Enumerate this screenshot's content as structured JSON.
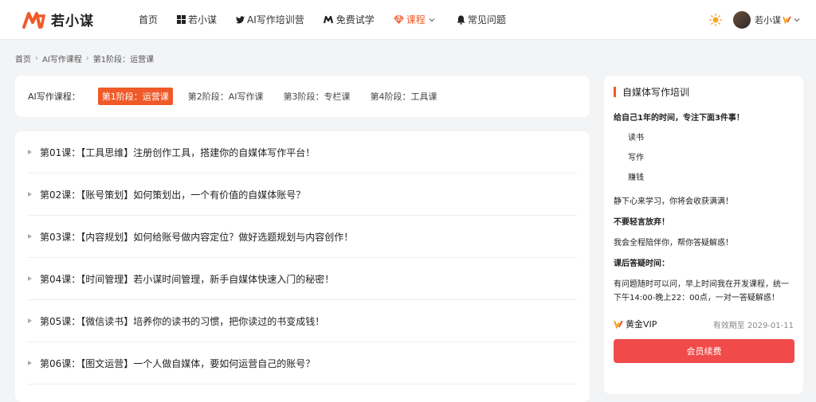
{
  "brand": {
    "name": "若小谋",
    "accent": "#f05a28"
  },
  "nav": [
    {
      "label": "首页",
      "icon": ""
    },
    {
      "label": "若小谋",
      "icon": "windows-icon"
    },
    {
      "label": "AI写作培训营",
      "icon": "twitter-bird-icon"
    },
    {
      "label": "免费试学",
      "icon": "m-logo-icon"
    },
    {
      "label": "课程",
      "icon": "diamond-icon",
      "active": true,
      "dropdown": true
    },
    {
      "label": "常见问题",
      "icon": "bell-icon"
    }
  ],
  "user": {
    "name": "若小谋"
  },
  "breadcrumb": [
    "首页",
    "AI写作课程",
    "第1阶段：运营课"
  ],
  "stages": {
    "label": "AI写作课程：",
    "tabs": [
      "第1阶段：运营课",
      "第2阶段：AI写作课",
      "第3阶段：专栏课",
      "第4阶段：工具课"
    ]
  },
  "lessons": [
    "第01课：【工具思维】注册创作工具，搭建你的自媒体写作平台！",
    "第02课：【账号策划】如何策划出，一个有价值的自媒体账号？",
    "第03课：【内容规划】如何给账号做内容定位？做好选题规划与内容创作！",
    "第04课：【时间管理】若小谋时间管理，新手自媒体快速入门的秘密！",
    "第05课：【微信读书】培养你的读书的习惯，把你读过的书变成钱！",
    "第06课：【图文运营】一个人做自媒体，要如何运营自己的账号？"
  ],
  "sidebar": {
    "title": "自媒体写作培训",
    "intro": "给自己1年的时间，专注下面3件事！",
    "items": [
      "读书",
      "写作",
      "赚钱"
    ],
    "p1": "静下心来学习，你将会收获满满！",
    "p2": "不要轻言放弃！",
    "p3": "我会全程陪伴你，帮你答疑解惑！",
    "p4": "课后答疑时间：",
    "p5": "有问题随时可以问，早上时间我在开发课程，统一下午14:00-晚上22：00点，一对一答疑解惑！",
    "vip_label": "黄金VIP",
    "expiry": "有效期至 2029-01-11",
    "renew_label": "会员续费",
    "renew_color": "#f04a4a"
  }
}
